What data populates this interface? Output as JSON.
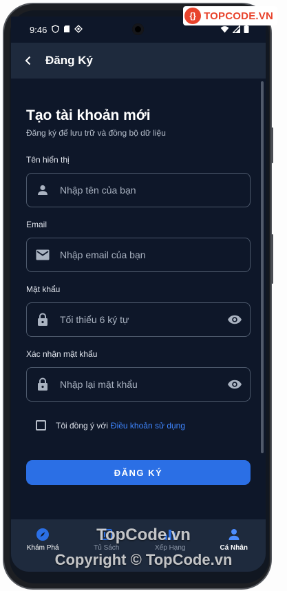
{
  "status_bar": {
    "time": "9:46"
  },
  "app_bar": {
    "title": "Đăng Ký",
    "back_icon": "chevron-left-icon"
  },
  "form": {
    "heading": "Tạo tài khoản mới",
    "subheading": "Đăng ký để lưu trữ và đồng bộ dữ liệu",
    "display_name": {
      "label": "Tên hiển thị",
      "placeholder": "Nhập tên của bạn",
      "icon": "person-icon"
    },
    "email": {
      "label": "Email",
      "placeholder": "Nhập email của bạn",
      "icon": "mail-icon"
    },
    "password": {
      "label": "Mật khẩu",
      "placeholder": "Tối thiểu 6 ký tự",
      "icon": "lock-icon",
      "toggle_icon": "eye-icon"
    },
    "confirm_password": {
      "label": "Xác nhận mật khẩu",
      "placeholder": "Nhập lại mật khẩu",
      "icon": "lock-icon",
      "toggle_icon": "eye-icon"
    },
    "terms": {
      "checked": false,
      "text": "Tôi đồng ý với",
      "link": "Điều khoản sử dụng"
    },
    "submit_label": "ĐĂNG KÝ"
  },
  "bottom_nav": {
    "items": [
      {
        "label": "Khám Phá",
        "icon": "compass-icon"
      },
      {
        "label": "Tủ Sách",
        "icon": "bookshelf-icon"
      },
      {
        "label": "Xếp Hạng",
        "icon": "ranking-icon"
      },
      {
        "label": "Cá Nhân",
        "icon": "person-icon",
        "active": true
      }
    ]
  },
  "watermark": {
    "logo_text": "TOPCODE.VN",
    "center_text": "TopCode.vn",
    "copyright_text": "Copyright © TopCode.vn"
  },
  "colors": {
    "background": "#0e1729",
    "surface": "#1e2a3d",
    "primary": "#2b6fe5",
    "link": "#3f86ff",
    "watermark_red": "#e8432c"
  }
}
